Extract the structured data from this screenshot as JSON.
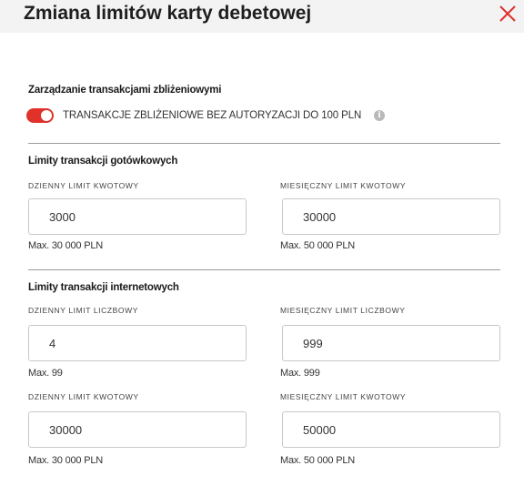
{
  "dialog": {
    "title": "Zmiana limitów karty debetowej"
  },
  "contactless": {
    "section_title": "Zarządzanie transakcjami zbliżeniowymi",
    "toggle_on": true,
    "toggle_label": "TRANSAKCJE ZBLIŻENIOWE BEZ AUTORYZACJI DO 100 PLN",
    "info_glyph": "i"
  },
  "cash": {
    "section_title": "Limity transakcji gotówkowych",
    "daily_amount": {
      "label": "DZIENNY LIMIT KWOTOWY",
      "value": "3000",
      "hint": "Max. 30 000 PLN"
    },
    "monthly_amount": {
      "label": "MIESIĘCZNY LIMIT KWOTOWY",
      "value": "30000",
      "hint": "Max. 50 000 PLN"
    }
  },
  "internet": {
    "section_title": "Limity transakcji internetowych",
    "daily_count": {
      "label": "DZIENNY LIMIT LICZBOWY",
      "value": "4",
      "hint": "Max. 99"
    },
    "monthly_count": {
      "label": "MIESIĘCZNY LIMIT LICZBOWY",
      "value": "999",
      "hint": "Max. 999"
    },
    "daily_amount": {
      "label": "DZIENNY LIMIT KWOTOWY",
      "value": "30000",
      "hint": "Max. 30 000 PLN"
    },
    "monthly_amount": {
      "label": "MIESIĘCZNY LIMIT KWOTOWY",
      "value": "50000",
      "hint": "Max. 50 000 PLN"
    }
  },
  "colors": {
    "accent": "#e0312b",
    "header_bg": "#f3f3f3"
  },
  "icons": {
    "close": "close-icon",
    "info": "info-icon"
  }
}
